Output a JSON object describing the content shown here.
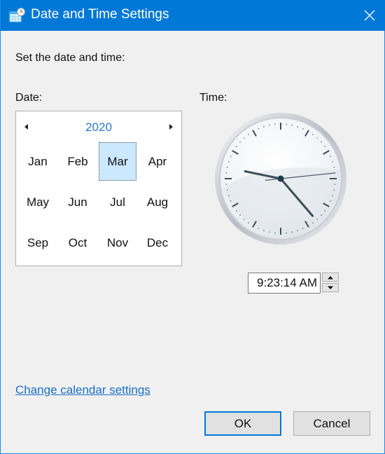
{
  "window": {
    "title": "Date and Time Settings",
    "title_icon": "calendar-clock-icon",
    "close_icon": "close-icon",
    "accent_color": "#0078d7"
  },
  "main": {
    "instruction": "Set the date and time:",
    "date_label": "Date:",
    "time_label": "Time:"
  },
  "calendar": {
    "year": "2020",
    "prev_icon": "triangle-left-icon",
    "next_icon": "triangle-right-icon",
    "selected_month": "Mar",
    "selection_color": "#cce8ff",
    "months": [
      "Jan",
      "Feb",
      "Mar",
      "Apr",
      "May",
      "Jun",
      "Jul",
      "Aug",
      "Sep",
      "Oct",
      "Nov",
      "Dec"
    ]
  },
  "clock": {
    "hours": 9,
    "minutes": 23,
    "seconds": 14
  },
  "time": {
    "value": "9:23:14 AM",
    "spin_up_icon": "triangle-up-icon",
    "spin_down_icon": "triangle-down-icon"
  },
  "links": {
    "change_calendar": "Change calendar settings"
  },
  "buttons": {
    "ok": "OK",
    "cancel": "Cancel"
  }
}
